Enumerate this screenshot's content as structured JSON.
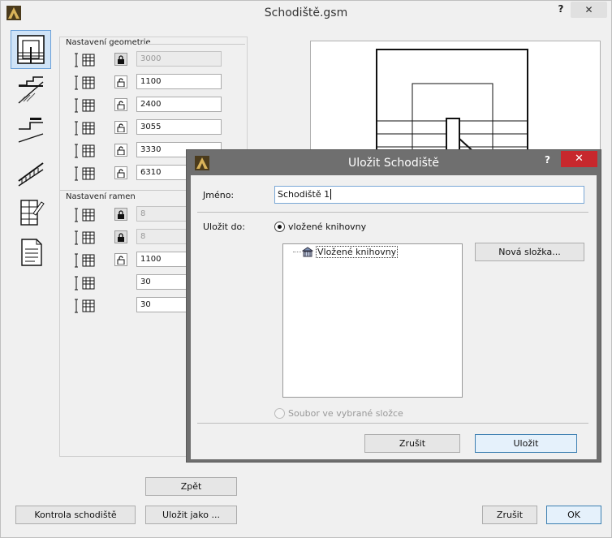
{
  "window": {
    "title": "Schodiště.gsm",
    "help_label": "?",
    "close_label": "✕"
  },
  "side_tabs": [
    {
      "name": "geometry-tab-icon",
      "selected": true
    },
    {
      "name": "stair-section-tab-icon",
      "selected": false
    },
    {
      "name": "stair-profile-tab-icon",
      "selected": false
    },
    {
      "name": "railing-tab-icon",
      "selected": false
    },
    {
      "name": "material-tab-icon",
      "selected": false
    },
    {
      "name": "listing-tab-icon",
      "selected": false
    }
  ],
  "geometry": {
    "group_label": "Nastavení geometrie",
    "rows": [
      {
        "icon": "rise-icon",
        "locked": true,
        "value": "3000",
        "disabled": true
      },
      {
        "icon": "stair-width-icon",
        "locked": false,
        "value": "1100",
        "disabled": false
      },
      {
        "icon": "landing-width-icon",
        "locked": false,
        "value": "2400",
        "disabled": false
      },
      {
        "icon": "total-length-icon",
        "locked": false,
        "value": "3055",
        "disabled": false
      },
      {
        "icon": "flight-length-icon",
        "locked": false,
        "value": "3330",
        "disabled": false
      },
      {
        "icon": "overall-size-icon",
        "locked": false,
        "value": "6310",
        "disabled": false
      }
    ]
  },
  "flights": {
    "group_label": "Nastavení ramen",
    "rows": [
      {
        "icon": "steps-count-icon",
        "locked": true,
        "value": "8",
        "disabled": true
      },
      {
        "icon": "steps-second-icon",
        "locked": true,
        "value": "8",
        "disabled": true
      },
      {
        "icon": "flight-width-icon",
        "locked": false,
        "value": "1100",
        "disabled": false
      },
      {
        "icon": "tread-top-icon",
        "locked": null,
        "value": "30",
        "disabled": false
      },
      {
        "icon": "tread-bottom-icon",
        "locked": null,
        "value": "30",
        "disabled": false
      }
    ]
  },
  "buttons": {
    "back": "Zpět",
    "check": "Kontrola schodiště",
    "save_as": "Uložit jako ...",
    "cancel": "Zrušit",
    "ok": "OK"
  },
  "dialog": {
    "title": "Uložit Schodiště",
    "help_label": "?",
    "close_label": "✕",
    "name_label": "Jméno:",
    "name_value": "Schodiště 1",
    "save_to_label": "Uložit do:",
    "radio_embedded": "vložené knihovny",
    "tree_node": "Vložené knihovny",
    "new_folder": "Nová složka...",
    "radio_file": "Soubor ve vybrané složce",
    "cancel": "Zrušit",
    "save": "Uložit"
  }
}
